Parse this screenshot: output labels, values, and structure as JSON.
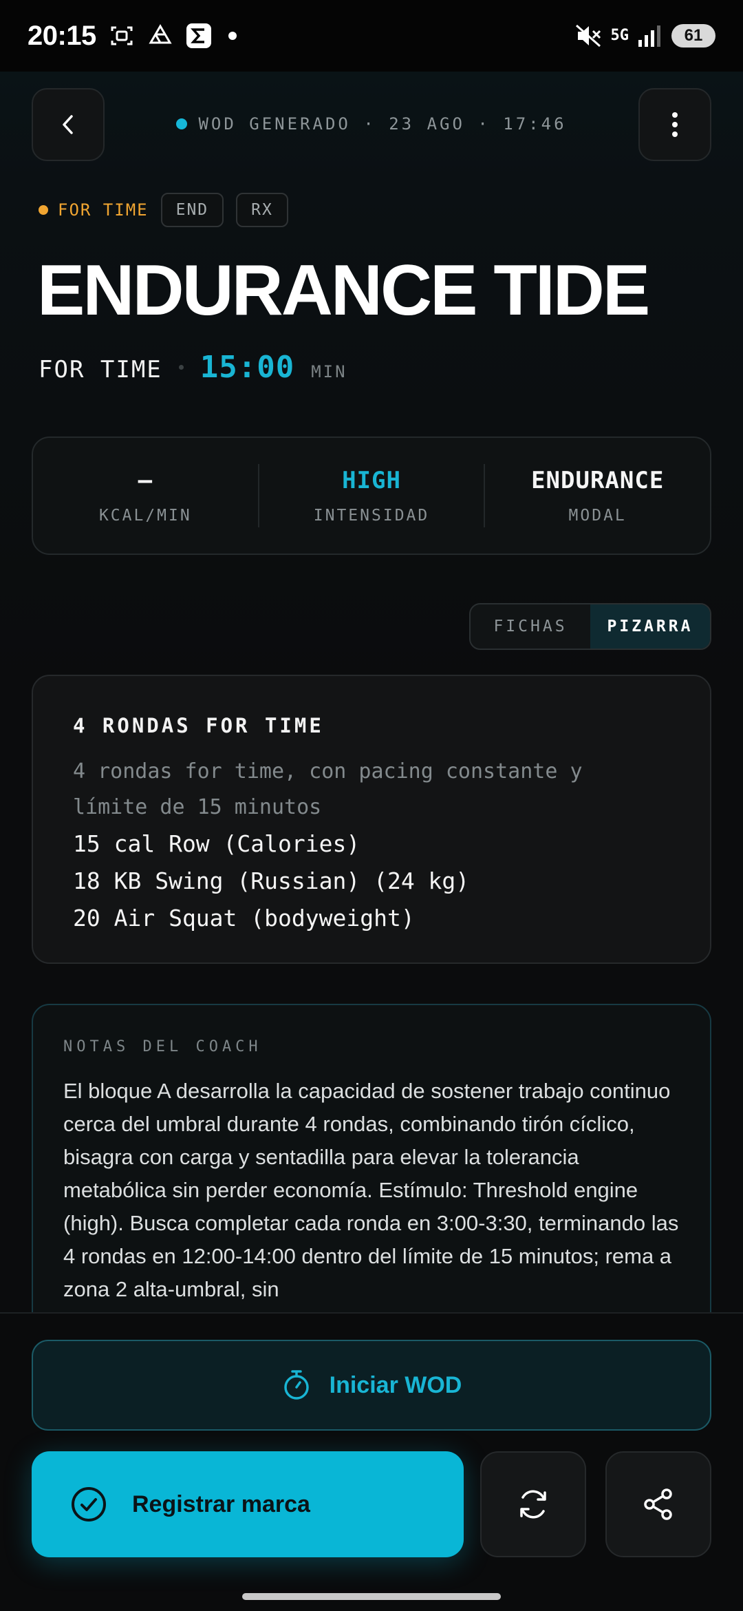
{
  "status_bar": {
    "time": "20:15",
    "battery": "61",
    "network": "5G",
    "icons": [
      "screenshot-icon",
      "drive-icon",
      "sigma-app-icon",
      "notification-dot",
      "mute-icon",
      "signal-icon",
      "battery-icon"
    ]
  },
  "header": {
    "subtitle": "WOD GENERADO · 23 AGO · 17:46",
    "accent_color": "#16b7d8"
  },
  "tags": {
    "type": "FOR TIME",
    "chips": [
      "END",
      "RX"
    ]
  },
  "workout": {
    "title": "ENDURANCE TIDE",
    "format": "FOR TIME",
    "time": "15:00",
    "time_unit": "MIN"
  },
  "stats": [
    {
      "value": "–",
      "label": "KCAL/MIN"
    },
    {
      "value": "HIGH",
      "label": "INTENSIDAD"
    },
    {
      "value": "ENDURANCE",
      "label": "MODAL"
    }
  ],
  "view_toggle": {
    "options": [
      "FICHAS",
      "PIZARRA"
    ],
    "active": "PIZARRA"
  },
  "board": {
    "heading": "4 RONDAS FOR TIME",
    "description": "4 rondas for time, con pacing constante y límite de 15 minutos",
    "lines": [
      "15 cal Row (Calories)",
      "18 KB Swing (Russian) (24 kg)",
      "20 Air Squat (bodyweight)"
    ]
  },
  "coach_notes": {
    "heading": "NOTAS DEL COACH",
    "text": "El bloque A desarrolla la capacidad de sostener trabajo continuo cerca del umbral durante 4 rondas, combinando tirón cíclico, bisagra con carga y sentadilla para elevar la tolerancia metabólica sin perder economía. Estímulo: Threshold engine (high). Busca completar cada ronda en 3:00-3:30, terminando las 4 rondas en 12:00-14:00 dentro del límite de 15 minutos; rema a zona 2 alta-umbral, sin"
  },
  "actions": {
    "start_label": "Iniciar WOD",
    "register_label": "Registrar marca",
    "primary_color": "#09b6d6"
  }
}
